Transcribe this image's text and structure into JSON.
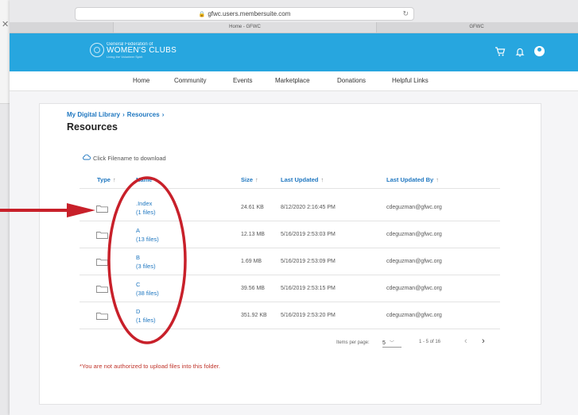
{
  "browser": {
    "url": "gfwc.users.membersuite.com",
    "tab_active": "Home - GFWC",
    "tab_other": "GFWC"
  },
  "logo": {
    "line1": "General Federation of",
    "line2": "WOMEN'S CLUBS",
    "line3": "Living the Volunteer Spirit"
  },
  "header_icons": [
    "cart-icon",
    "bell-icon",
    "avatar-icon"
  ],
  "nav": [
    "Home",
    "Community",
    "Events",
    "Marketplace",
    "Donations",
    "Helpful Links"
  ],
  "breadcrumb": [
    "My Digital Library",
    "Resources"
  ],
  "page_title": "Resources",
  "hint": "Click Filename to download",
  "columns": {
    "type": "Type",
    "name": "Name",
    "size": "Size",
    "updated": "Last Updated",
    "updated_by": "Last Updated By"
  },
  "rows": [
    {
      "name": ".Index",
      "files": "(1 files)",
      "size": "24.61 KB",
      "updated": "8/12/2020 2:16:45 PM",
      "by": "cdeguzman@gfwc.org"
    },
    {
      "name": "A",
      "files": "(13 files)",
      "size": "12.13 MB",
      "updated": "5/16/2019 2:53:03 PM",
      "by": "cdeguzman@gfwc.org"
    },
    {
      "name": "B",
      "files": "(3 files)",
      "size": "1.69 MB",
      "updated": "5/16/2019 2:53:09 PM",
      "by": "cdeguzman@gfwc.org"
    },
    {
      "name": "C",
      "files": "(38 files)",
      "size": "39.56 MB",
      "updated": "5/16/2019 2:53:15 PM",
      "by": "cdeguzman@gfwc.org"
    },
    {
      "name": "D",
      "files": "(1 files)",
      "size": "351.92 KB",
      "updated": "5/16/2019 2:53:20 PM",
      "by": "cdeguzman@gfwc.org"
    }
  ],
  "pager": {
    "label": "Items per page:",
    "per_page": "5",
    "range": "1 - 5 of 16"
  },
  "warning": "*You are not authorized to upload files into this folder.",
  "colors": {
    "brand": "#27a6df",
    "link": "#1f77c0",
    "warning": "#c0352c",
    "annotation": "#c8202a"
  }
}
